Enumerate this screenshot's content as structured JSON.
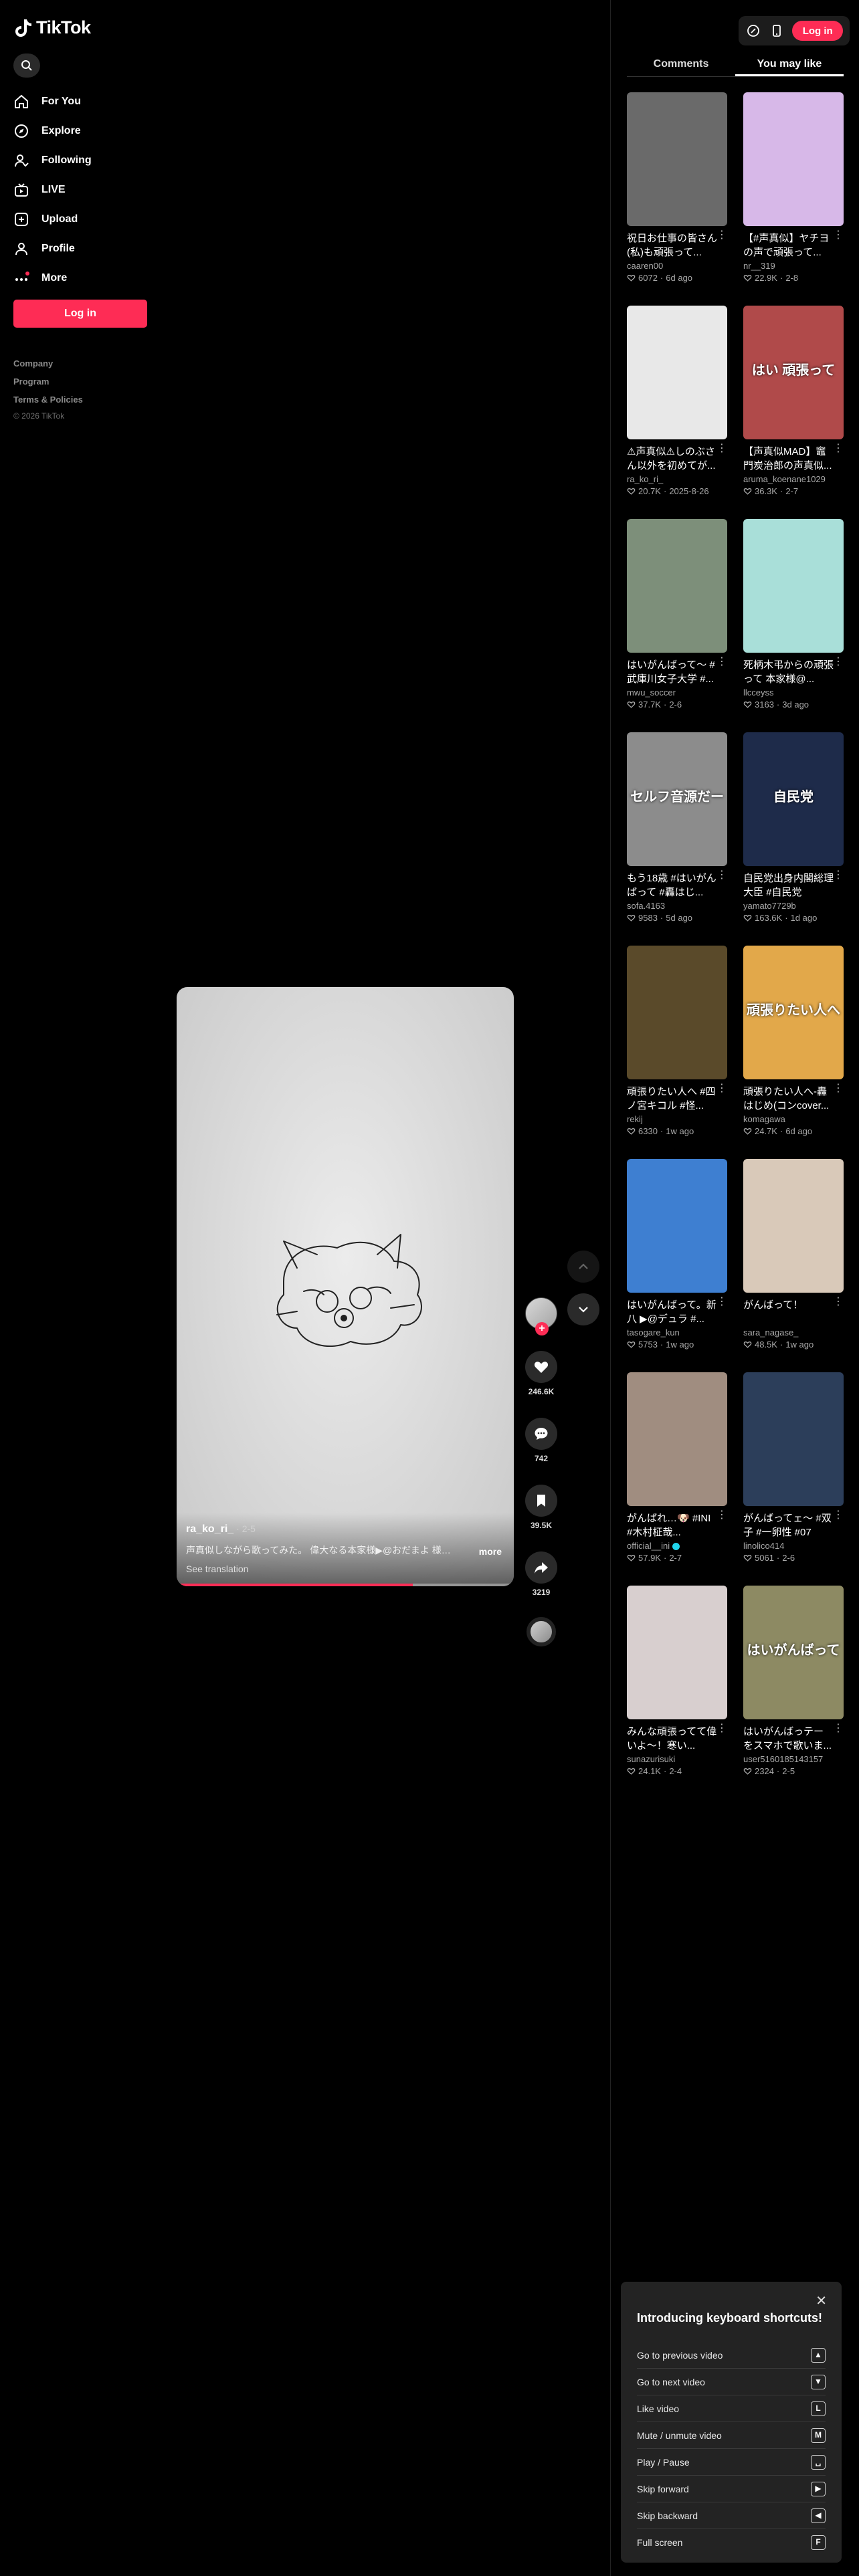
{
  "app": {
    "brand": "TikTok"
  },
  "sidebar": {
    "search_label": "",
    "nav": [
      {
        "label": "For You",
        "icon": "home-icon"
      },
      {
        "label": "Explore",
        "icon": "compass-icon"
      },
      {
        "label": "Following",
        "icon": "following-icon"
      },
      {
        "label": "LIVE",
        "icon": "live-icon"
      },
      {
        "label": "Upload",
        "icon": "upload-icon"
      },
      {
        "label": "Profile",
        "icon": "profile-icon"
      },
      {
        "label": "More",
        "icon": "more-icon"
      }
    ],
    "login_label": "Log in",
    "footer": {
      "company": "Company",
      "program": "Program",
      "terms": "Terms & Policies",
      "copyright": "© 2026 TikTok"
    }
  },
  "video": {
    "author": "ra_ko_ri_",
    "date": "· 2-5",
    "caption": "声真似しながら歌ってみた。 偉大なる本家様▶@おだまよ 様#声...",
    "more_label": "more",
    "see_translation": "See translation",
    "progress": 0.7,
    "likes": "246.6K",
    "comments": "742",
    "saves": "39.5K",
    "shares": "3219",
    "follow_symbol": "+"
  },
  "right_panel": {
    "login_label": "Log in",
    "tabs": [
      {
        "label": "Comments"
      },
      {
        "label": "You may like"
      }
    ],
    "cards": [
      {
        "title": "祝日お仕事の皆さん(私)も頑張って...",
        "user": "caaren00",
        "likes": "6072",
        "date": "6d ago",
        "verified": false,
        "thumb_text": "",
        "bg": "#6a6a6a"
      },
      {
        "title": "【#声真似】ヤチヨの声で頑張って...",
        "user": "nr__319",
        "likes": "22.9K",
        "date": "2-8",
        "verified": false,
        "thumb_text": "",
        "bg": "#d7b8e8"
      },
      {
        "title": "⚠声真似⚠しのぶさん以外を初めてが...",
        "user": "ra_ko_ri_",
        "likes": "20.7K",
        "date": "2025-8-26",
        "verified": false,
        "thumb_text": "",
        "bg": "#e8e8e8"
      },
      {
        "title": "【声真似MAD】竈門炭治郎の声真似...",
        "user": "aruma_koenane1029",
        "likes": "36.3K",
        "date": "2-7",
        "verified": false,
        "thumb_text": "はい 頑張って",
        "bg": "#b04a4a"
      },
      {
        "title": "はいがんばって〜 #武庫川女子大学 #...",
        "user": "mwu_soccer",
        "likes": "37.7K",
        "date": "2-6",
        "verified": false,
        "thumb_text": "",
        "bg": "#7d8f7a"
      },
      {
        "title": "死柄木弔からの頑張って 本家様@...",
        "user": "llcceyss",
        "likes": "3163",
        "date": "3d ago",
        "verified": false,
        "thumb_text": "",
        "bg": "#a9dfd9"
      },
      {
        "title": "もう18歳 #はいがんばって #轟はじ...",
        "user": "sofa.4163",
        "likes": "9583",
        "date": "5d ago",
        "verified": false,
        "thumb_text": "セルフ音源だー",
        "bg": "#8c8c8c"
      },
      {
        "title": "自民党出身内閣総理大臣 #自民党",
        "user": "yamato7729b",
        "likes": "163.6K",
        "date": "1d ago",
        "verified": false,
        "thumb_text": "自民党",
        "bg": "#1e2b4a"
      },
      {
        "title": "頑張りたい人へ #四ノ宮キコル #怪...",
        "user": "rekij",
        "likes": "6330",
        "date": "1w ago",
        "verified": false,
        "thumb_text": "",
        "bg": "#5a4a2a"
      },
      {
        "title": "頑張りたい人へ-轟はじめ(コンcover...",
        "user": "komagawa",
        "likes": "24.7K",
        "date": "6d ago",
        "verified": false,
        "thumb_text": "頑張りたい人へ",
        "bg": "#e2a84a"
      },
      {
        "title": "はいがんばって。新八 ▶@デュラ #...",
        "user": "tasogare_kun",
        "likes": "5753",
        "date": "1w ago",
        "verified": false,
        "thumb_text": "",
        "bg": "#3e7fd1"
      },
      {
        "title": "がんばって！",
        "user": "sara_nagase_",
        "likes": "48.5K",
        "date": "1w ago",
        "verified": false,
        "thumb_text": "",
        "bg": "#d9c9b9"
      },
      {
        "title": "がんばれ…🐶 #INI #木村柾哉...",
        "user": "official__ini",
        "likes": "57.9K",
        "date": "2-7",
        "verified": true,
        "thumb_text": "",
        "bg": "#a08d80"
      },
      {
        "title": "がんばってェ〜 #双子 #一卵性 #07",
        "user": "linolico414",
        "likes": "5061",
        "date": "2-6",
        "verified": false,
        "thumb_text": "",
        "bg": "#2c3e5a"
      },
      {
        "title": "みんな頑張ってて偉いよ〜！寒い...",
        "user": "sunazurisuki",
        "likes": "24.1K",
        "date": "2-4",
        "verified": false,
        "thumb_text": "",
        "bg": "#d8cfcf"
      },
      {
        "title": "はいがんばっテー をスマホで歌いま...",
        "user": "user5160185143157",
        "likes": "2324",
        "date": "2-5",
        "verified": false,
        "thumb_text": "はいがんばって",
        "bg": "#8d8a63"
      }
    ]
  },
  "shortcuts": {
    "title": "Introducing keyboard shortcuts!",
    "close_symbol": "✕",
    "items": [
      {
        "label": "Go to previous video",
        "key": "▲"
      },
      {
        "label": "Go to next video",
        "key": "▼"
      },
      {
        "label": "Like video",
        "key": "L"
      },
      {
        "label": "Mute / unmute video",
        "key": "M"
      },
      {
        "label": "Play / Pause",
        "key": "␣"
      },
      {
        "label": "Skip forward",
        "key": "▶"
      },
      {
        "label": "Skip backward",
        "key": "◀"
      },
      {
        "label": "Full screen",
        "key": "F"
      }
    ]
  },
  "colors": {
    "accent": "#fe2c55",
    "background": "#000000",
    "panel": "#232323"
  }
}
